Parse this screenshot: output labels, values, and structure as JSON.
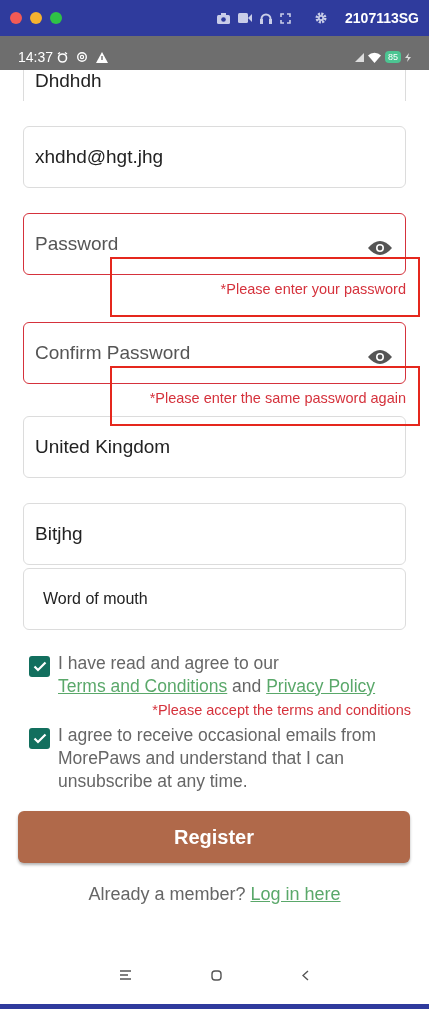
{
  "window": {
    "title": "2107113SG"
  },
  "status_bar": {
    "time": "14:37",
    "battery": "85"
  },
  "fields": [
    {
      "kind": "text",
      "value": "Dhdhdh",
      "invalid": false
    },
    {
      "kind": "text",
      "value": "xhdhd@hgt.jhg",
      "invalid": false
    },
    {
      "kind": "password",
      "placeholder": "Password",
      "invalid": true,
      "error": "*Please enter your password",
      "highlighted": true
    },
    {
      "kind": "password",
      "placeholder": "Confirm Password",
      "invalid": true,
      "error": "*Please enter the same password again",
      "highlighted": true
    },
    {
      "kind": "text",
      "value": "United Kingdom",
      "invalid": false
    },
    {
      "kind": "text",
      "value": "Bitjhg",
      "invalid": false
    },
    {
      "kind": "select",
      "value": "Word of mouth",
      "invalid": false
    }
  ],
  "agreements": [
    {
      "checked": true,
      "text_before": "I have read and agree to our ",
      "link_1": "Terms and Conditions",
      "text_middle": " and ",
      "link_2": "Privacy Policy",
      "error": "*Please accept the terms and conditions"
    },
    {
      "checked": true,
      "text": "I agree to receive occasional emails from MorePaws and understand that I can unsubscribe at any time."
    }
  ],
  "register_button": "Register",
  "login_prompt": {
    "text": "Already a member?",
    "link": "Log in here"
  }
}
